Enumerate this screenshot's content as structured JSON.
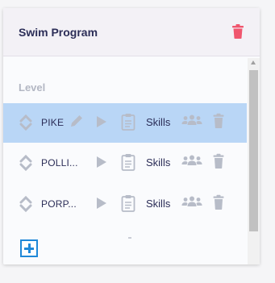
{
  "panel": {
    "title": "Swim Program",
    "section_label": "Level"
  },
  "levels": [
    {
      "name": "PIKE",
      "action_label": "Skills",
      "selected": true,
      "editable": true
    },
    {
      "name": "POLLI...",
      "action_label": "Skills",
      "selected": false,
      "editable": false
    },
    {
      "name": "PORP...",
      "action_label": "Skills",
      "selected": false,
      "editable": false
    }
  ],
  "colors": {
    "title": "#2c2e58",
    "delete_header": "#f0566e",
    "selected_row": "#b9d6f6",
    "icon_muted": "#b7bcc8",
    "add_button": "#1f88d8"
  },
  "icons": {
    "header_delete": "trash-icon",
    "reorder": "reorder-arrows-icon",
    "edit": "pencil-icon",
    "play": "play-icon",
    "clipboard": "clipboard-icon",
    "group": "group-icon",
    "delete": "trash-icon",
    "add": "plus-square-icon"
  }
}
